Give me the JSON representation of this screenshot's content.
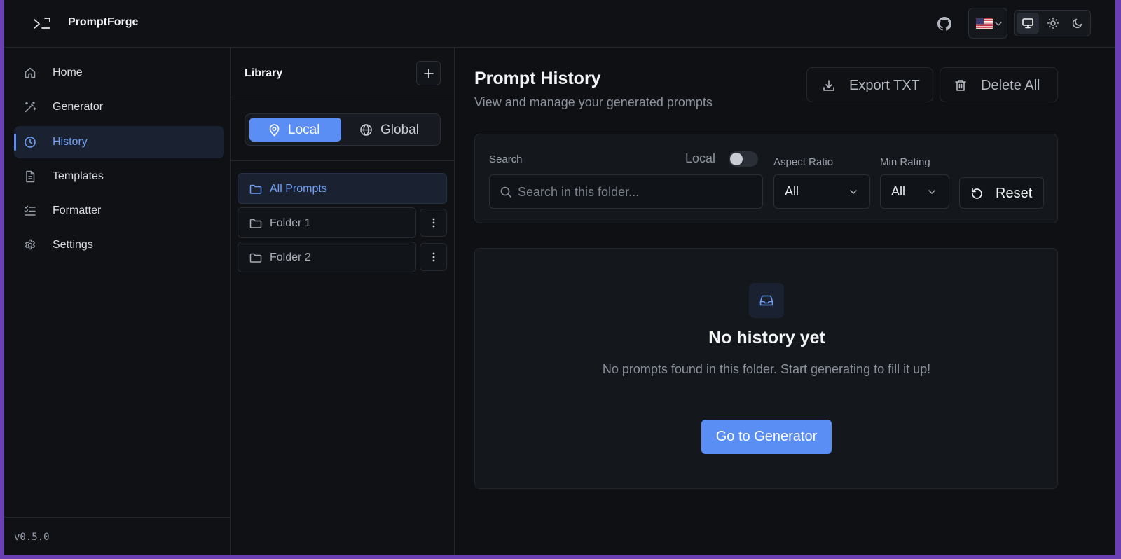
{
  "app": {
    "brand": "PromptForge",
    "version": "v0.5.0"
  },
  "topbar": {
    "language_flag": "flag-us-icon",
    "theme_modes": [
      "system",
      "light",
      "dark"
    ],
    "active_theme": "system"
  },
  "sidebar": {
    "items": [
      {
        "label": "Home",
        "icon": "home-icon"
      },
      {
        "label": "Generator",
        "icon": "wand-icon"
      },
      {
        "label": "History",
        "icon": "clock-icon",
        "active": true
      },
      {
        "label": "Templates",
        "icon": "file-icon"
      },
      {
        "label": "Formatter",
        "icon": "list-check-icon"
      },
      {
        "label": "Settings",
        "icon": "gear-icon"
      }
    ]
  },
  "library": {
    "title": "Library",
    "scope": {
      "local_label": "Local",
      "global_label": "Global",
      "active": "local"
    },
    "folders": [
      {
        "label": "All Prompts",
        "active": true
      },
      {
        "label": "Folder 1"
      },
      {
        "label": "Folder 2"
      }
    ]
  },
  "main": {
    "title": "Prompt History",
    "subtitle": "View and manage your generated prompts",
    "export_label": "Export TXT",
    "delete_label": "Delete All",
    "filters": {
      "search_label": "Search",
      "local_toggle_label": "Local",
      "local_toggle_on": false,
      "search_placeholder": "Search in this folder...",
      "search_value": "",
      "aspect_ratio_label": "Aspect Ratio",
      "aspect_ratio_value": "All",
      "min_rating_label": "Min Rating",
      "min_rating_value": "All",
      "reset_label": "Reset"
    },
    "empty_state": {
      "icon": "inbox-icon",
      "title": "No history yet",
      "description": "No prompts found in this folder. Start generating to fill it up!",
      "cta_label": "Go to Generator"
    }
  },
  "colors": {
    "accent": "#5b8ef5",
    "background": "#0e1014",
    "surface": "#14171c",
    "border": "#23262d",
    "window_frame": "#6a3fb3"
  }
}
